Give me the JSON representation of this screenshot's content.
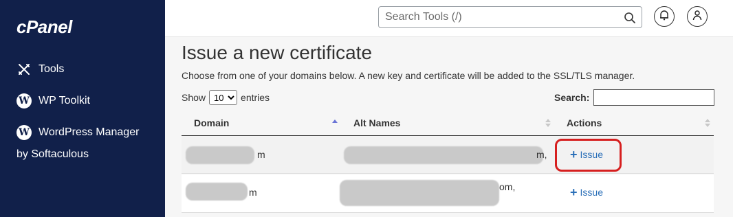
{
  "sidebar": {
    "logo": "cPanel",
    "items": [
      {
        "label": "Tools",
        "icon": "tools-icon"
      },
      {
        "label": "WP Toolkit",
        "icon": "wordpress-icon"
      },
      {
        "label": "WordPress Manager",
        "icon": "wordpress-icon"
      }
    ],
    "wpm_line2": "by Softaculous"
  },
  "header": {
    "search_placeholder": "Search Tools (/)",
    "search_icon": "search-icon",
    "bell_icon": "bell-icon",
    "user_icon": "user-icon"
  },
  "main": {
    "title": "Issue a new certificate",
    "description": "Choose from one of your domains below. A new key and certificate will be added to the SSL/TLS manager.",
    "show_label": "Show",
    "entries_value": "10",
    "entries_label": "entries",
    "search_label": "Search:",
    "columns": [
      "Domain",
      "Alt Names",
      "Actions"
    ],
    "rows": [
      {
        "domain_tail": "m",
        "alt_tail": "m,",
        "action": "Issue"
      },
      {
        "domain_tail": "m",
        "alt_tail": "om,",
        "action": "Issue"
      }
    ]
  },
  "colors": {
    "sidebar_bg": "#11204a",
    "link": "#2a6fb8",
    "highlight": "#d61f1f"
  }
}
